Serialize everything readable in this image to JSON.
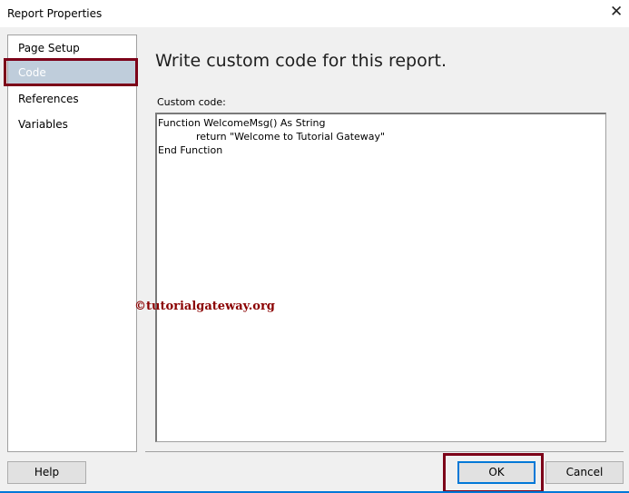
{
  "window": {
    "title": "Report Properties",
    "close_icon": "close-icon"
  },
  "sidebar": {
    "items": [
      {
        "label": "Page Setup"
      },
      {
        "label": "Code",
        "selected": true
      },
      {
        "label": "References"
      },
      {
        "label": "Variables"
      }
    ]
  },
  "main": {
    "heading": "Write custom code for this report.",
    "code_label": "Custom code:",
    "code_value": "Function WelcomeMsg() As String\n            return \"Welcome to Tutorial Gateway\"\nEnd Function"
  },
  "watermark": "©tutorialgateway.org",
  "buttons": {
    "help": "Help",
    "ok": "OK",
    "cancel": "Cancel"
  },
  "colors": {
    "highlight": "#7c0018",
    "selection": "#bfcddb",
    "focus": "#0078d7"
  }
}
